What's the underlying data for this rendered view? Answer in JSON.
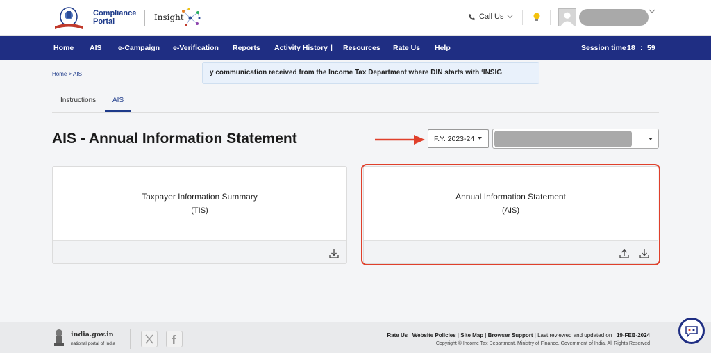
{
  "header": {
    "brand_line1": "Compliance",
    "brand_line2": "Portal",
    "insight": "Insight",
    "call_us": "Call Us"
  },
  "nav": {
    "items": [
      "Home",
      "AIS",
      "e-Campaign",
      "e-Verification",
      "Reports",
      "Activity History",
      "|",
      "Resources",
      "Rate Us",
      "Help"
    ],
    "active": "AIS",
    "session_label": "Session time",
    "session_min": "18",
    "session_colon": ":",
    "session_sec": "59"
  },
  "breadcrumb": {
    "home": "Home",
    "sep": ">",
    "current": "AIS"
  },
  "notice": "y communication received from the Income Tax Department where DIN starts with ‘INSIG",
  "tabs": [
    "Instructions",
    "AIS"
  ],
  "active_tab": "AIS",
  "page_title": "AIS - Annual Information Statement",
  "fy_select": "F.Y. 2023-24",
  "cards": [
    {
      "title": "Taxpayer Information Summary",
      "sub": "(TIS)"
    },
    {
      "title": "Annual Information Statement",
      "sub": "(AIS)"
    }
  ],
  "footer": {
    "india_name": "india.gov.in",
    "india_sub": "national portal of India",
    "link_rate": "Rate Us",
    "link_policies": "Website Policies",
    "link_sitemap": "Site Map",
    "link_browser": "Browser Support",
    "reviewed_label": "Last reviewed and updated on : ",
    "reviewed_date": "19-FEB-2024",
    "copyright": "Copyright © Income Tax Department, Ministry of Finance, Government of India. All Rights Reserved"
  },
  "colors": {
    "nav_bg": "#1f2e83",
    "highlight": "#e0402b",
    "brand": "#1d3a8a"
  },
  "icons": [
    "phone-icon",
    "chevron-down-icon",
    "bulb-icon",
    "download-icon",
    "upload-icon",
    "x-social-icon",
    "facebook-icon",
    "chatbot-icon",
    "arrow-right-icon"
  ]
}
